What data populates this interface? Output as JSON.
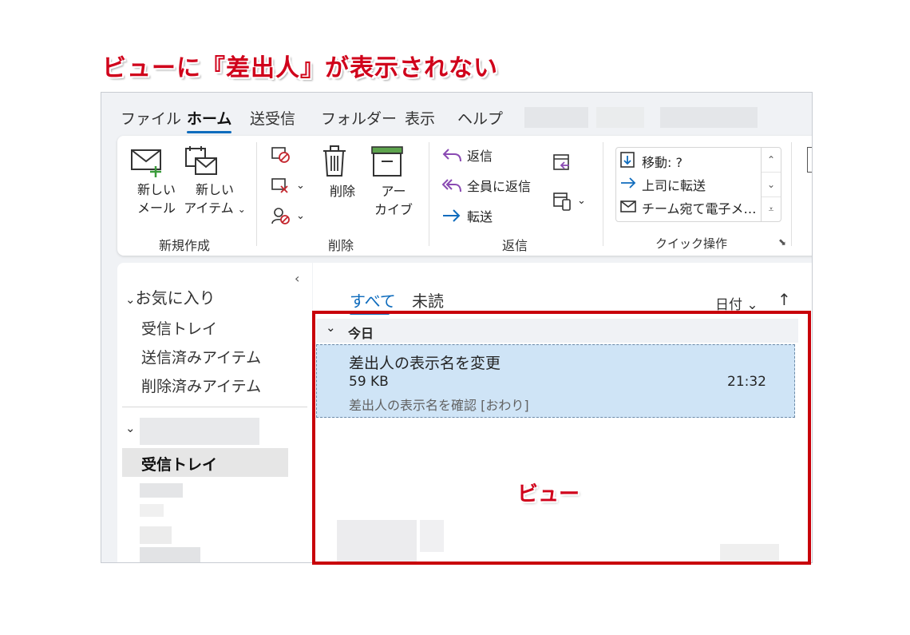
{
  "annotation": {
    "title": "ビューに『差出人』が表示されない",
    "view_label": "ビュー"
  },
  "menu": {
    "items": [
      "ファイル",
      "ホーム",
      "送受信",
      "フォルダー",
      "表示",
      "ヘルプ"
    ],
    "active": "ホーム"
  },
  "ribbon": {
    "new_group": {
      "new_mail_l1": "新しい",
      "new_mail_l2": "メール",
      "new_item_l1": "新しい",
      "new_item_l2": "アイテム",
      "label": "新規作成"
    },
    "delete_group": {
      "delete": "削除",
      "archive_l1": "アー",
      "archive_l2": "カイブ",
      "label": "削除"
    },
    "reply_group": {
      "reply": "返信",
      "reply_all": "全員に返信",
      "forward": "転送",
      "label": "返信"
    },
    "quick_group": {
      "move": "移動: ?",
      "to_manager": "上司に転送",
      "team_email": "チーム宛て電子メ…",
      "label": "クイック操作"
    }
  },
  "nav": {
    "favorites": "お気に入り",
    "fav_items": [
      "受信トレイ",
      "送信済みアイテム",
      "削除済みアイテム"
    ],
    "inbox_selected": "受信トレイ"
  },
  "mail_list": {
    "tabs": [
      "すべて",
      "未読"
    ],
    "sort_label": "日付",
    "group_today": "今日",
    "selected_message": {
      "subject": "差出人の表示名を変更",
      "size": "59 KB",
      "time": "21:32",
      "preview": "差出人の表示名を確認 [おわり]"
    }
  },
  "colors": {
    "accent": "#0f6cbd",
    "annotation_red": "#d0021b",
    "selected_row": "#cfe4f6"
  }
}
